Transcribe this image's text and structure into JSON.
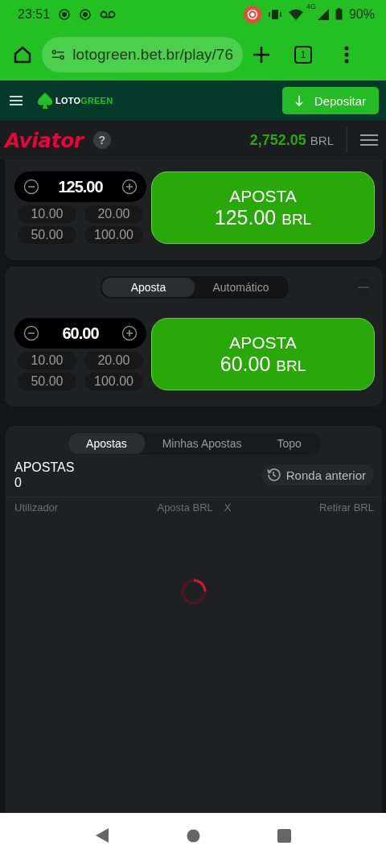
{
  "status_bar": {
    "time": "23:51",
    "network": "4G",
    "battery": "90%"
  },
  "browser": {
    "url": "lotogreen.bet.br/play/76",
    "tab_count": "1"
  },
  "site_header": {
    "logo_a": "LOTO",
    "logo_b": "GREEN",
    "deposit_button": "Depositar"
  },
  "game_header": {
    "title": "Aviator",
    "help": "?",
    "balance": "2,752.05",
    "currency": "BRL"
  },
  "bet_panels": [
    {
      "amount": "125.00",
      "quick_amounts": [
        "10.00",
        "20.00",
        "50.00",
        "100.00"
      ],
      "button_label": "APOSTA",
      "button_amount": "125.00",
      "button_currency": "BRL"
    },
    {
      "tabs": [
        {
          "label": "Aposta",
          "selected": true
        },
        {
          "label": "Automático",
          "selected": false
        }
      ],
      "amount": "60.00",
      "quick_amounts": [
        "10.00",
        "20.00",
        "50.00",
        "100.00"
      ],
      "button_label": "APOSTA",
      "button_amount": "60.00",
      "button_currency": "BRL"
    }
  ],
  "bets": {
    "tabs": [
      {
        "label": "Apostas",
        "selected": true
      },
      {
        "label": "Minhas Apostas",
        "selected": false
      },
      {
        "label": "Topo",
        "selected": false
      }
    ],
    "title": "APOSTAS",
    "count": "0",
    "history_button": "Ronda anterior",
    "columns": [
      "Utilizador",
      "Aposta BRL",
      "X",
      "Retirar BRL"
    ],
    "loading": true
  }
}
